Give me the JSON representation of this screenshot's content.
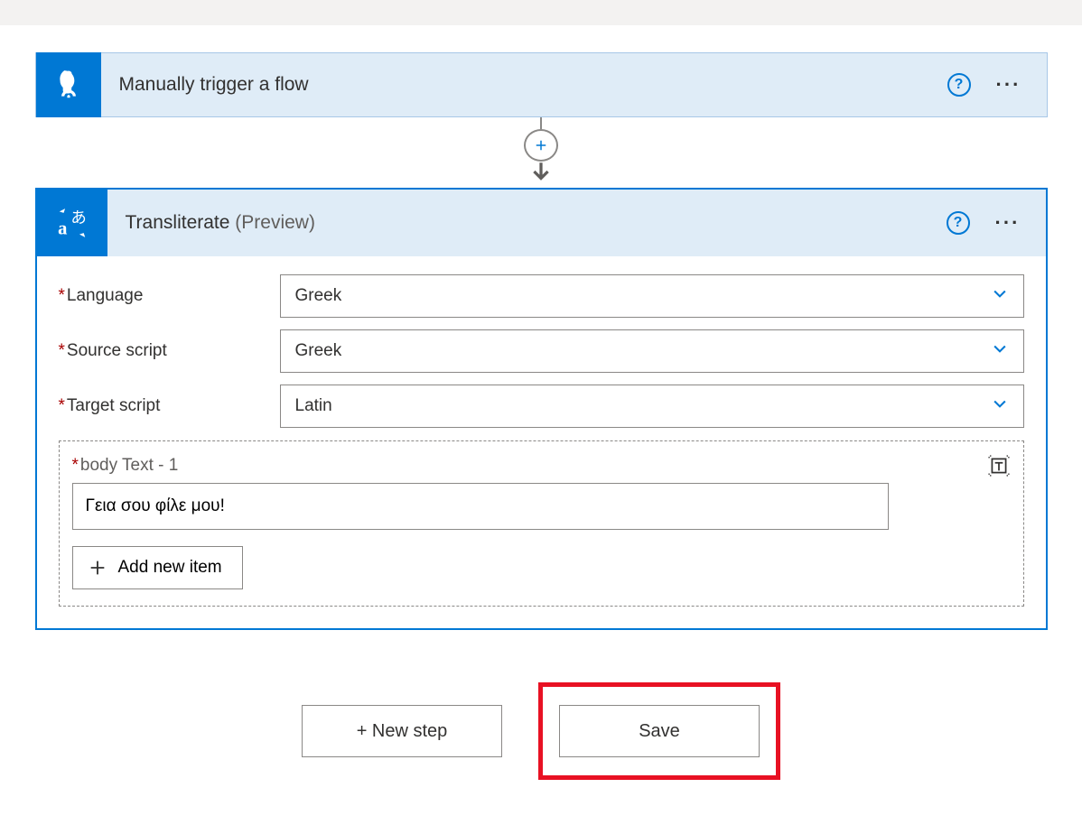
{
  "trigger": {
    "title": "Manually trigger a flow"
  },
  "action": {
    "title": "Transliterate",
    "preview_suffix": "(Preview)",
    "fields": {
      "language": {
        "label": "Language",
        "value": "Greek"
      },
      "source_script": {
        "label": "Source script",
        "value": "Greek"
      },
      "target_script": {
        "label": "Target script",
        "value": "Latin"
      }
    },
    "body": {
      "label": "body Text - 1",
      "value": "Γεια σου φίλε μου!",
      "add_button": "Add new item"
    }
  },
  "footer": {
    "new_step": "+ New step",
    "save": "Save"
  },
  "glyphs": {
    "help": "?",
    "more": "···"
  }
}
